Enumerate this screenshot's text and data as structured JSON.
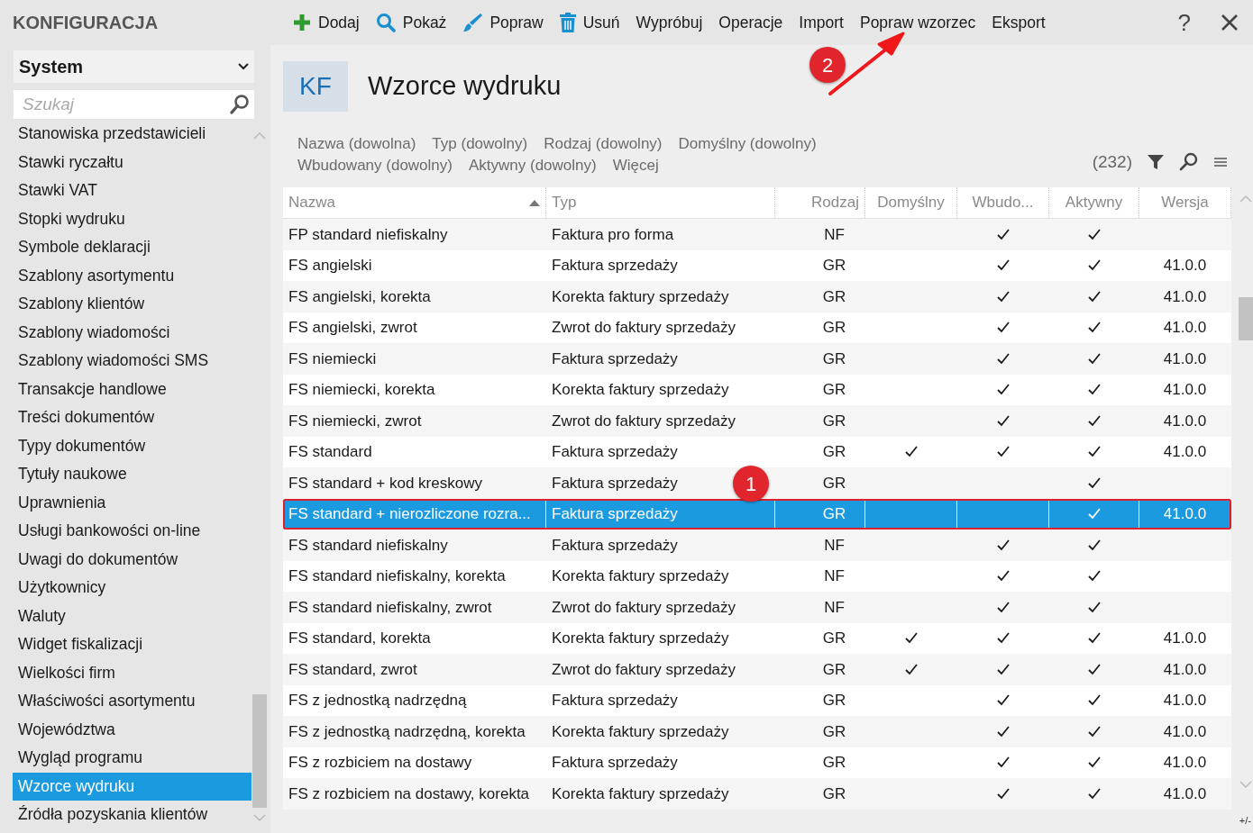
{
  "app_title": "KONFIGURACJA",
  "toolbar": [
    {
      "label": "Dodaj",
      "kind": "plus"
    },
    {
      "label": "Pokaż",
      "kind": "search"
    },
    {
      "label": "Popraw",
      "kind": "brush"
    },
    {
      "label": "Usuń",
      "kind": "trash"
    },
    {
      "label": "Wypróbuj",
      "kind": "text"
    },
    {
      "label": "Operacje",
      "kind": "text"
    },
    {
      "label": "Import",
      "kind": "text"
    },
    {
      "label": "Popraw wzorzec",
      "kind": "text"
    },
    {
      "label": "Eksport",
      "kind": "text"
    }
  ],
  "help_label": "?",
  "sidebar": {
    "section": "System",
    "search": {
      "placeholder": "Szukaj"
    },
    "items": [
      {
        "label": "Stanowiska przedstawicieli",
        "selected": false
      },
      {
        "label": "Stawki ryczałtu",
        "selected": false
      },
      {
        "label": "Stawki VAT",
        "selected": false
      },
      {
        "label": "Stopki wydruku",
        "selected": false
      },
      {
        "label": "Symbole deklaracji",
        "selected": false
      },
      {
        "label": "Szablony asortymentu",
        "selected": false
      },
      {
        "label": "Szablony klientów",
        "selected": false
      },
      {
        "label": "Szablony wiadomości",
        "selected": false
      },
      {
        "label": "Szablony wiadomości SMS",
        "selected": false
      },
      {
        "label": "Transakcje handlowe",
        "selected": false
      },
      {
        "label": "Treści dokumentów",
        "selected": false
      },
      {
        "label": "Typy dokumentów",
        "selected": false
      },
      {
        "label": "Tytuły naukowe",
        "selected": false
      },
      {
        "label": "Uprawnienia",
        "selected": false
      },
      {
        "label": "Usługi bankowości on-line",
        "selected": false
      },
      {
        "label": "Uwagi do dokumentów",
        "selected": false
      },
      {
        "label": "Użytkownicy",
        "selected": false
      },
      {
        "label": "Waluty",
        "selected": false
      },
      {
        "label": "Widget fiskalizacji",
        "selected": false
      },
      {
        "label": "Wielkości firm",
        "selected": false
      },
      {
        "label": "Właściwości asortymentu",
        "selected": false
      },
      {
        "label": "Województwa",
        "selected": false
      },
      {
        "label": "Wygląd programu",
        "selected": false
      },
      {
        "label": "Wzorce wydruku",
        "selected": true
      },
      {
        "label": "Źródła pozyskania klientów",
        "selected": false
      }
    ]
  },
  "page": {
    "badge": "KF",
    "title": "Wzorce wydruku"
  },
  "filters": [
    [
      "Nazwa (dowolna)",
      "Typ (dowolny)",
      "Rodzaj (dowolny)",
      "Domyślny (dowolny)"
    ],
    [
      "Wbudowany (dowolny)",
      "Aktywny (dowolny)",
      "Więcej"
    ]
  ],
  "count": "(232)",
  "table": {
    "columns": [
      {
        "label": "Nazwa",
        "sorted": true
      },
      {
        "label": "Typ",
        "sorted": false
      },
      {
        "label": "Rodzaj",
        "sorted": false
      },
      {
        "label": "Domyślny",
        "sorted": false
      },
      {
        "label": "Wbudo...",
        "sorted": false
      },
      {
        "label": "Aktywny",
        "sorted": false
      },
      {
        "label": "Wersja",
        "sorted": false
      }
    ],
    "rows": [
      {
        "name": "FP standard niefiskalny",
        "type": "Faktura pro forma",
        "kind": "NF",
        "default": false,
        "builtin": true,
        "active": true,
        "selected": false
      },
      {
        "name": "FS angielski",
        "type": "Faktura sprzedaży",
        "kind": "GR",
        "default": false,
        "builtin": true,
        "active": true,
        "version": "41.0.0",
        "selected": false
      },
      {
        "name": "FS angielski, korekta",
        "type": "Korekta faktury sprzedaży",
        "kind": "GR",
        "default": false,
        "builtin": true,
        "active": true,
        "version": "41.0.0",
        "selected": false
      },
      {
        "name": "FS angielski, zwrot",
        "type": "Zwrot do faktury sprzedaży",
        "kind": "GR",
        "default": false,
        "builtin": true,
        "active": true,
        "version": "41.0.0",
        "selected": false
      },
      {
        "name": "FS niemiecki",
        "type": "Faktura sprzedaży",
        "kind": "GR",
        "default": false,
        "builtin": true,
        "active": true,
        "version": "41.0.0",
        "selected": false
      },
      {
        "name": "FS niemiecki, korekta",
        "type": "Korekta faktury sprzedaży",
        "kind": "GR",
        "default": false,
        "builtin": true,
        "active": true,
        "version": "41.0.0",
        "selected": false
      },
      {
        "name": "FS niemiecki, zwrot",
        "type": "Zwrot do faktury sprzedaży",
        "kind": "GR",
        "default": false,
        "builtin": true,
        "active": true,
        "version": "41.0.0",
        "selected": false
      },
      {
        "name": "FS standard",
        "type": "Faktura sprzedaży",
        "kind": "GR",
        "default": true,
        "builtin": true,
        "active": true,
        "version": "41.0.0",
        "selected": false
      },
      {
        "name": "FS standard + kod kreskowy",
        "type": "Faktura sprzedaży",
        "kind": "GR",
        "default": false,
        "builtin": false,
        "active": true,
        "selected": false
      },
      {
        "name": "FS standard + nierozliczone rozra...",
        "type": "Faktura sprzedaży",
        "kind": "GR",
        "default": false,
        "builtin": false,
        "active": true,
        "version": "41.0.0",
        "selected": true
      },
      {
        "name": "FS standard niefiskalny",
        "type": "Faktura sprzedaży",
        "kind": "NF",
        "default": false,
        "builtin": true,
        "active": true,
        "selected": false
      },
      {
        "name": "FS standard niefiskalny, korekta",
        "type": "Korekta faktury sprzedaży",
        "kind": "NF",
        "default": false,
        "builtin": true,
        "active": true,
        "selected": false
      },
      {
        "name": "FS standard niefiskalny, zwrot",
        "type": "Zwrot do faktury sprzedaży",
        "kind": "NF",
        "default": false,
        "builtin": true,
        "active": true,
        "selected": false
      },
      {
        "name": "FS standard, korekta",
        "type": "Korekta faktury sprzedaży",
        "kind": "GR",
        "default": true,
        "builtin": true,
        "active": true,
        "version": "41.0.0",
        "selected": false
      },
      {
        "name": "FS standard, zwrot",
        "type": "Zwrot do faktury sprzedaży",
        "kind": "GR",
        "default": true,
        "builtin": true,
        "active": true,
        "version": "41.0.0",
        "selected": false
      },
      {
        "name": "FS z jednostką nadrzędną",
        "type": "Faktura sprzedaży",
        "kind": "GR",
        "default": false,
        "builtin": true,
        "active": true,
        "version": "41.0.0",
        "selected": false
      },
      {
        "name": "FS z jednostką nadrzędną, korekta",
        "type": "Korekta faktury sprzedaży",
        "kind": "GR",
        "default": false,
        "builtin": true,
        "active": true,
        "version": "41.0.0",
        "selected": false
      },
      {
        "name": "FS z rozbiciem na dostawy",
        "type": "Faktura sprzedaży",
        "kind": "GR",
        "default": false,
        "builtin": true,
        "active": true,
        "version": "41.0.0",
        "selected": false
      },
      {
        "name": "FS z rozbiciem na dostawy, korekta",
        "type": "Korekta faktury sprzedaży",
        "kind": "GR",
        "default": false,
        "builtin": true,
        "active": true,
        "version": "41.0.0",
        "selected": false
      }
    ]
  },
  "zoom_label": "+/-",
  "annotations": [
    {
      "label": "1"
    },
    {
      "label": "2"
    }
  ]
}
